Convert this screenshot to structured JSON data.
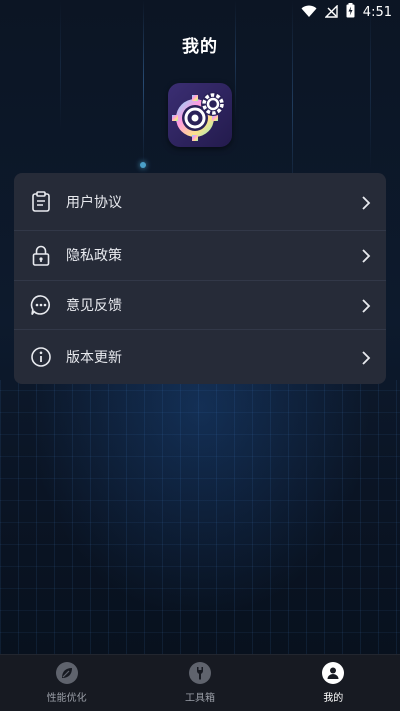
{
  "status_bar": {
    "time": "4:51",
    "icons": [
      "wifi-icon",
      "no-signal-icon",
      "battery-charging-icon"
    ]
  },
  "header": {
    "title": "我的"
  },
  "app_logo": {
    "icon": "gear-logo-icon"
  },
  "menu": {
    "items": [
      {
        "label": "用户协议",
        "icon": "clipboard-icon"
      },
      {
        "label": "隐私政策",
        "icon": "lock-icon"
      },
      {
        "label": "意见反馈",
        "icon": "chat-bubble-icon"
      },
      {
        "label": "版本更新",
        "icon": "info-icon"
      }
    ]
  },
  "tabbar": {
    "tabs": [
      {
        "label": "性能优化",
        "icon": "leaf-icon",
        "active": false
      },
      {
        "label": "工具箱",
        "icon": "wrench-icon",
        "active": false
      },
      {
        "label": "我的",
        "icon": "user-icon",
        "active": true
      }
    ]
  },
  "colors": {
    "background": "#0c1524",
    "card": "#262b38",
    "tabbar": "#171a22",
    "accent_glow": "#4aa0c8"
  }
}
